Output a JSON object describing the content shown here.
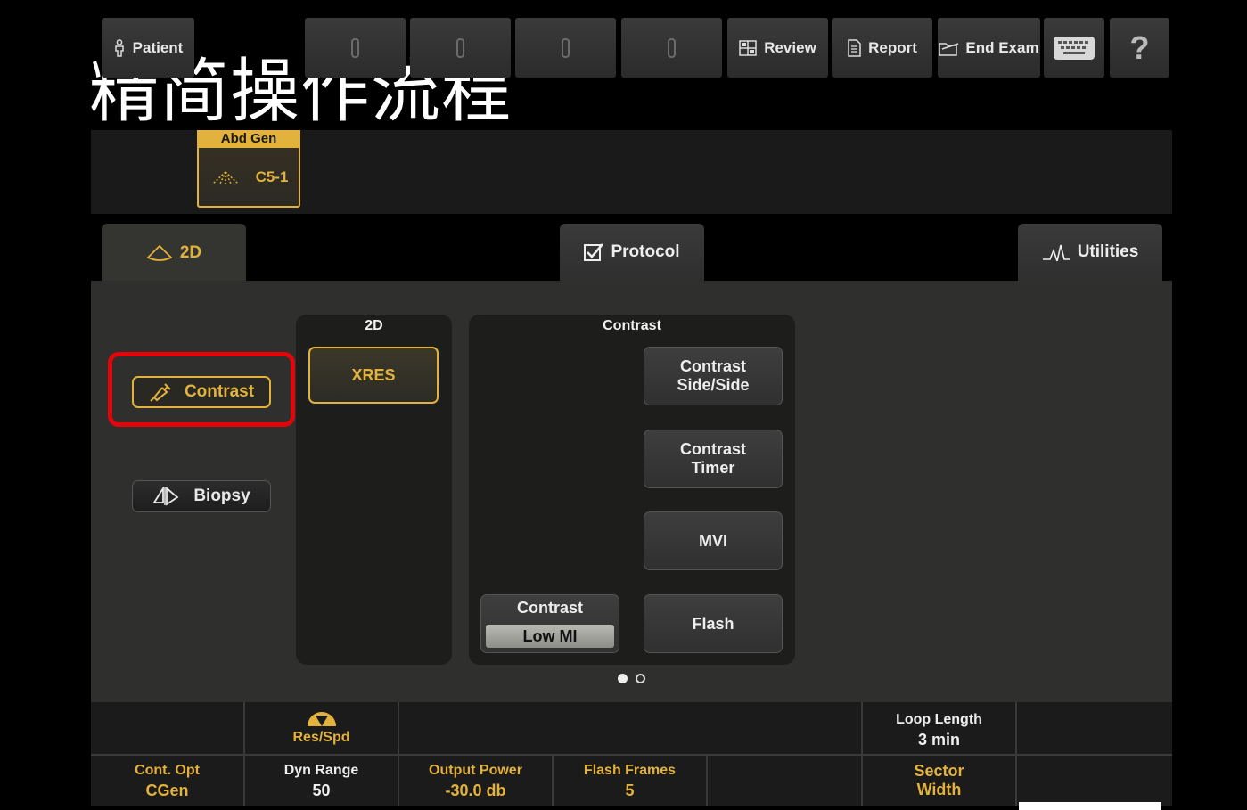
{
  "slide_title": "精简操作流程",
  "topbar": {
    "patient_label": "Patient",
    "preset_label": "Abd Gen",
    "transducer_label": "C5-1",
    "review_label": "Review",
    "report_label": "Report",
    "end_exam_label": "End Exam",
    "help_label": "?"
  },
  "tabs": {
    "twod_label": "2D",
    "protocol_label": "Protocol",
    "utilities_label": "Utilities"
  },
  "modes": {
    "contrast_label": "Contrast",
    "biopsy_label": "Biopsy"
  },
  "group_2d": {
    "title": "2D",
    "xres_label": "XRES"
  },
  "group_contrast": {
    "title": "Contrast",
    "side_side_line1": "Contrast",
    "side_side_line2": "Side/Side",
    "timer_line1": "Contrast",
    "timer_line2": "Timer",
    "mvi_label": "MVI",
    "flash_label": "Flash",
    "contrast_mi_label": "Contrast",
    "contrast_mi_value": "Low MI"
  },
  "bottom": {
    "res_spd_label": "Res/Spd",
    "loop_length_label": "Loop Length",
    "loop_length_value": "3 min",
    "cont_opt_label": "Cont. Opt",
    "cont_opt_value": "CGen",
    "dyn_range_label": "Dyn Range",
    "dyn_range_value": "50",
    "output_power_label": "Output Power",
    "output_power_value": "-30.0 db",
    "flash_frames_label": "Flash Frames",
    "flash_frames_value": "5",
    "sector_width_line1": "Sector",
    "sector_width_line2": "Width"
  },
  "colors": {
    "accent_gold": "#e3b23c",
    "highlight_red": "#e0060c",
    "panel": "#2f2f2d"
  },
  "page_indicator": {
    "current": 1,
    "total": 2
  }
}
